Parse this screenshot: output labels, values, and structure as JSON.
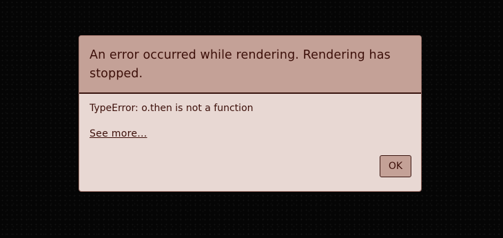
{
  "dialog": {
    "title": "An error occurred while rendering. Rendering has stopped.",
    "message": "TypeError: o.then is not a function",
    "see_more_label": "See more...",
    "ok_label": "OK"
  },
  "colors": {
    "page_background": "#050505",
    "header_background": "#c4a197",
    "body_background": "#e8d8d3",
    "text": "#3b0e08",
    "border": "#3a1510"
  }
}
